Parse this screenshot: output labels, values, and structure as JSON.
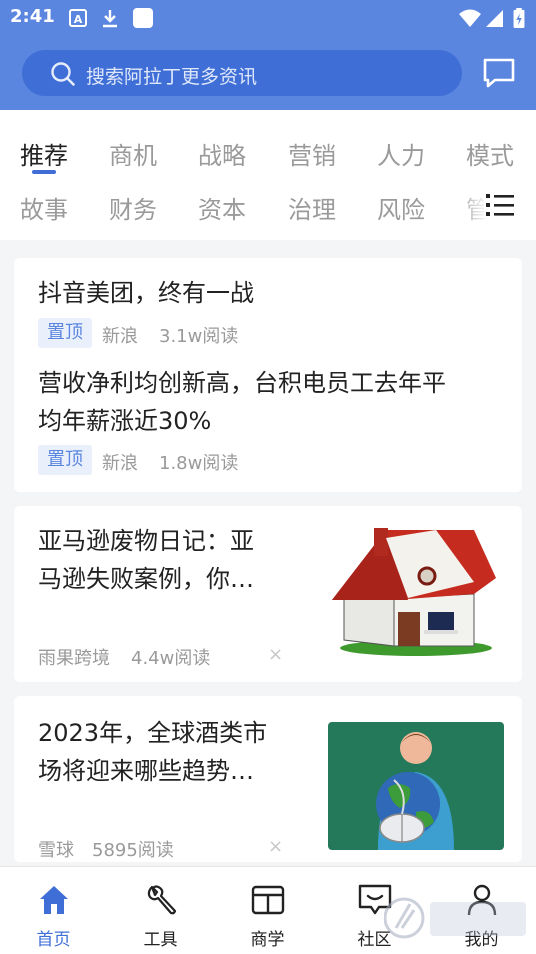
{
  "status": {
    "time": "2:41"
  },
  "search": {
    "placeholder": "搜索阿拉丁更多资讯"
  },
  "tabs": {
    "row1": [
      "推荐",
      "商机",
      "战略",
      "营销",
      "人力",
      "模式"
    ],
    "row2": [
      "故事",
      "财务",
      "资本",
      "治理",
      "风险",
      "管"
    ],
    "active": "推荐"
  },
  "feed": {
    "pinned": [
      {
        "title": "抖音美团，终有一战",
        "tag": "置顶",
        "source": "新浪",
        "reads": "3.1w阅读"
      },
      {
        "title_line1": "营收净利均创新高，台积电员工去年平",
        "title_line2": "均年薪涨近30%",
        "tag": "置顶",
        "source": "新浪",
        "reads": "1.8w阅读"
      }
    ],
    "articles": [
      {
        "title_line1": "亚马逊废物日记：亚",
        "title_line2": "马逊失败案例，你…",
        "source": "雨果跨境",
        "reads": "4.4w阅读",
        "close": "×",
        "image": "house-illustration"
      },
      {
        "title_line1": "2023年，全球酒类市",
        "title_line2": "场将迎来哪些趋势…",
        "source": "雪球",
        "reads": "5895阅读",
        "close": "×",
        "image": "globe-mouse-illustration"
      }
    ]
  },
  "bottom_nav": [
    {
      "label": "首页",
      "icon": "home-icon",
      "active": true
    },
    {
      "label": "工具",
      "icon": "wrench-icon",
      "active": false
    },
    {
      "label": "商学",
      "icon": "board-icon",
      "active": false
    },
    {
      "label": "社区",
      "icon": "chat-icon",
      "active": false
    },
    {
      "label": "我的",
      "icon": "person-icon",
      "active": false
    }
  ],
  "colors": {
    "brand": "#5b86e0",
    "brand_dark": "#3f6fd6",
    "muted": "#9a9a9a",
    "pin_bg": "#eaf0fb"
  }
}
